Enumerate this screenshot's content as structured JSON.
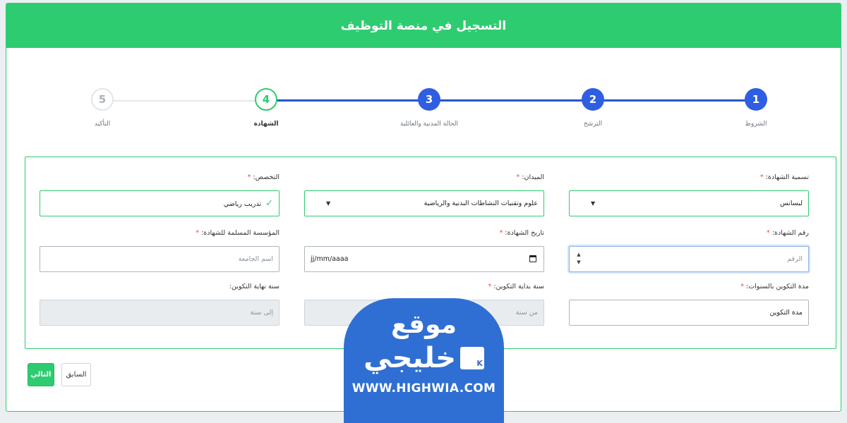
{
  "header": {
    "title": "التسجيل في منصة التوظيف"
  },
  "stepper": {
    "steps": [
      {
        "number": "1",
        "label": "الشروط",
        "state": "done"
      },
      {
        "number": "2",
        "label": "الترشح",
        "state": "done"
      },
      {
        "number": "3",
        "label": "الحالة المدنية والعائلية",
        "state": "done"
      },
      {
        "number": "4",
        "label": "الشهادة",
        "state": "active"
      },
      {
        "number": "5",
        "label": "التأكيد",
        "state": "todo"
      }
    ]
  },
  "form": {
    "degree_name": {
      "label": "تسمية الشهادة:",
      "required": "*",
      "value": "ليسانس"
    },
    "field": {
      "label": "الميدان:",
      "required": "*",
      "value": "علوم وتقنيات النشاطات البدنية والرياضية"
    },
    "specialty": {
      "label": "التخصص:",
      "required": "*",
      "value": "تدريب رياضي"
    },
    "degree_number": {
      "label": "رقم الشهادة:",
      "required": "*",
      "placeholder": "الرقم"
    },
    "degree_date": {
      "label": "تاريخ الشهادة:",
      "required": "*",
      "placeholder": "jj/mm/aaaa"
    },
    "institution": {
      "label": "المؤسسة المسلمة للشهادة:",
      "required": "*",
      "placeholder": "اسم الجامعة"
    },
    "training_years": {
      "label": "مدة التكوين بالسنوات:",
      "required": "*",
      "placeholder": "مدة التكوين"
    },
    "training_start": {
      "label": "سنة بداية التكوين:",
      "required": "*",
      "placeholder": "من سنة"
    },
    "training_end": {
      "label": "سنة نهاية التكوين:",
      "placeholder": "إلى سنة"
    }
  },
  "buttons": {
    "next": "التالي",
    "previous": "السابق"
  },
  "watermark": {
    "top": "موقع",
    "middle": "خليجي",
    "logo_letter": "K",
    "url": "WWW.HIGHWIA.COM"
  },
  "colors": {
    "accent": "#2ecc71",
    "step_done": "#2f5ee3",
    "required": "#e74c3c",
    "watermark": "#2f6fd3"
  }
}
